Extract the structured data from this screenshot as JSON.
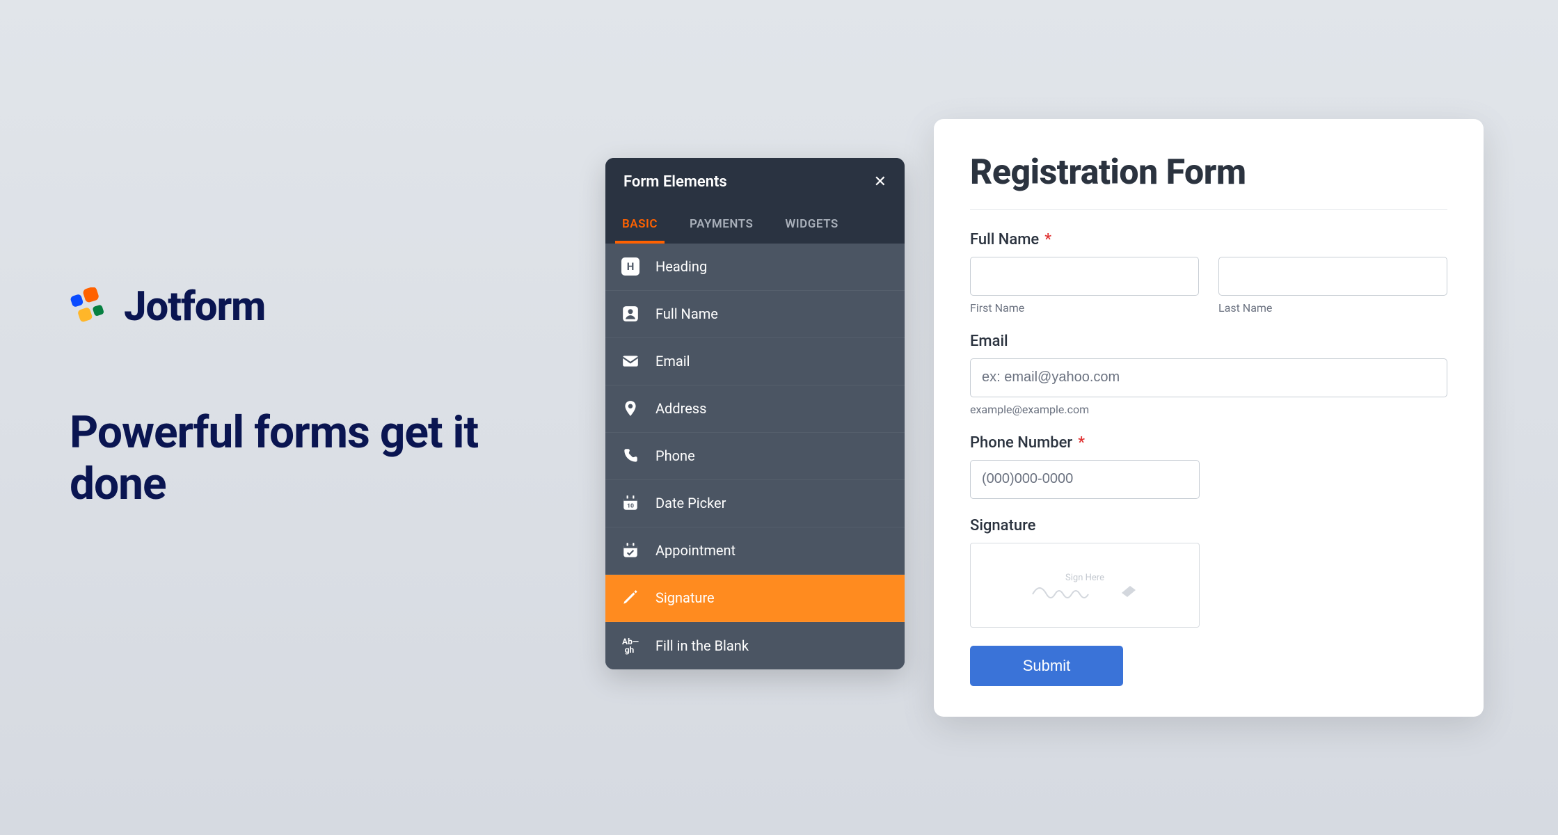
{
  "brand": {
    "name": "Jotform",
    "headline": "Powerful forms get it done"
  },
  "panel": {
    "title": "Form Elements",
    "tabs": [
      "BASIC",
      "PAYMENTS",
      "WIDGETS"
    ],
    "active_tab_index": 0,
    "elements": [
      {
        "icon": "heading",
        "label": "Heading"
      },
      {
        "icon": "person",
        "label": "Full Name"
      },
      {
        "icon": "envelope",
        "label": "Email"
      },
      {
        "icon": "pin",
        "label": "Address"
      },
      {
        "icon": "phone",
        "label": "Phone"
      },
      {
        "icon": "calendar-date",
        "label": "Date Picker"
      },
      {
        "icon": "calendar-check",
        "label": "Appointment"
      },
      {
        "icon": "pen",
        "label": "Signature"
      },
      {
        "icon": "blank-text",
        "label": "Fill in the Blank"
      }
    ],
    "active_element_index": 7
  },
  "form": {
    "title": "Registration Form",
    "fields": {
      "full_name": {
        "label": "Full Name",
        "required": true,
        "sub": {
          "first": "First Name",
          "last": "Last Name"
        }
      },
      "email": {
        "label": "Email",
        "placeholder": "ex: email@yahoo.com",
        "helper": "example@example.com"
      },
      "phone": {
        "label": "Phone Number",
        "required": true,
        "placeholder": "(000)000-0000"
      },
      "signature": {
        "label": "Signature",
        "placeholder": "Sign Here"
      }
    },
    "submit_label": "Submit"
  }
}
